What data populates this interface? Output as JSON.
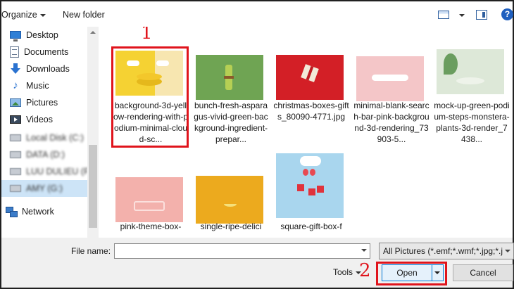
{
  "toolbar": {
    "organize_label": "Organize",
    "new_folder_label": "New folder",
    "help_glyph": "?"
  },
  "sidebar": {
    "items": [
      {
        "label": "Desktop",
        "icon": "desktop-icon"
      },
      {
        "label": "Documents",
        "icon": "documents-icon"
      },
      {
        "label": "Downloads",
        "icon": "downloads-icon"
      },
      {
        "label": "Music",
        "icon": "music-icon"
      },
      {
        "label": "Pictures",
        "icon": "pictures-icon"
      },
      {
        "label": "Videos",
        "icon": "videos-icon"
      },
      {
        "label": "Local Disk (C:)",
        "icon": "disk-icon"
      },
      {
        "label": "DATA (D:)",
        "icon": "disk-icon"
      },
      {
        "label": "LUU DULIEU (F:)",
        "icon": "disk-icon"
      },
      {
        "label": "AMY (G:)",
        "icon": "disk-icon"
      },
      {
        "label": "Network",
        "icon": "network-icon"
      }
    ],
    "music_glyph": "♪"
  },
  "files": [
    {
      "name": "background-3d-yellow-rendering-with-podium-minimal-cloud-sc..."
    },
    {
      "name": "bunch-fresh-asparagus-vivid-green-background-ingredient-prepar..."
    },
    {
      "name": "christmas-boxes-gifts_80090-4771.jpg"
    },
    {
      "name": "minimal-blank-search-bar-pink-background-3d-rendering_73903-5..."
    },
    {
      "name": "mock-up-green-podium-steps-monstera-plants-3d-render_7438..."
    },
    {
      "name": "pink-theme-box-"
    },
    {
      "name": "single-ripe-delici"
    },
    {
      "name": "square-gift-box-f"
    }
  ],
  "annotations": {
    "step1": "1",
    "step2": "2",
    "color": "#e0141c"
  },
  "bottom": {
    "file_name_label": "File name:",
    "file_name_value": "",
    "file_type_value": "All Pictures (*.emf;*.wmf;*.jpg;*.j",
    "tools_label": "Tools",
    "open_label": "Open",
    "cancel_label": "Cancel"
  }
}
